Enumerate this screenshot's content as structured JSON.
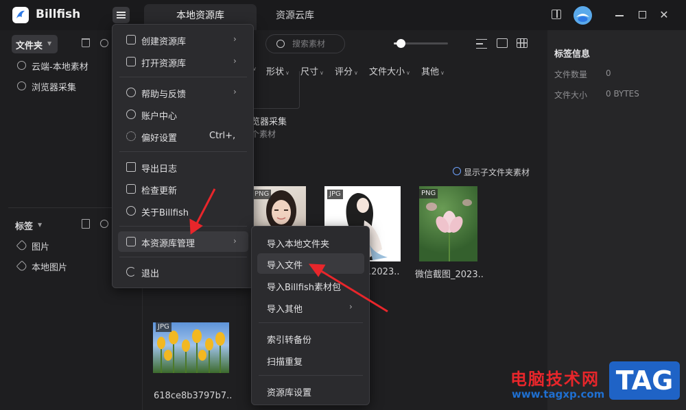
{
  "app": {
    "title": "Billfish",
    "tabs": [
      {
        "label": "本地资源库",
        "active": true
      },
      {
        "label": "资源云库",
        "active": false
      }
    ]
  },
  "sidebar": {
    "folder_header": "文件夹",
    "folders": [
      {
        "label": "云端-本地素材",
        "icon": "cloud-icon"
      },
      {
        "label": "浏览器采集",
        "icon": "compass-icon"
      }
    ],
    "tags_header": "标签",
    "tags": [
      {
        "label": "图片",
        "icon": "tag-icon"
      },
      {
        "label": "本地图片",
        "icon": "tag-icon"
      }
    ]
  },
  "toolbar": {
    "search_placeholder": "搜索素材",
    "filters": [
      "形状",
      "尺寸",
      "评分",
      "文件大小",
      "其他"
    ]
  },
  "content": {
    "folder_card": {
      "name": "览器采集",
      "count": "个素材"
    },
    "show_subfolder": "显示子文件夹素材",
    "thumbnails": [
      {
        "badge": "PNG",
        "name": ""
      },
      {
        "badge": "JPG",
        "name": ".2023.."
      },
      {
        "badge": "PNG",
        "name": "微信截图_2023.."
      },
      {
        "badge": "JPG",
        "name": "618ce8b3797b7.."
      }
    ]
  },
  "right_panel": {
    "title": "标签信息",
    "rows": [
      {
        "label": "文件数量",
        "value": "0"
      },
      {
        "label": "文件大小",
        "value": "0 BYTES"
      }
    ]
  },
  "main_menu": {
    "items": [
      {
        "label": "创建资源库",
        "shortcut": "",
        "has_submenu": true
      },
      {
        "label": "打开资源库",
        "shortcut": "",
        "has_submenu": true
      },
      {
        "label": "帮助与反馈",
        "shortcut": "",
        "has_submenu": true
      },
      {
        "label": "账户中心",
        "shortcut": "",
        "has_submenu": false
      },
      {
        "label": "偏好设置",
        "shortcut": "Ctrl+,",
        "has_submenu": false
      },
      {
        "label": "导出日志",
        "shortcut": "",
        "has_submenu": false
      },
      {
        "label": "检查更新",
        "shortcut": "",
        "has_submenu": false
      },
      {
        "label": "关于Billfish",
        "shortcut": "",
        "has_submenu": false
      },
      {
        "label": "本资源库管理",
        "shortcut": "",
        "has_submenu": true,
        "highlighted": true
      },
      {
        "label": "退出",
        "shortcut": "",
        "has_submenu": false
      }
    ]
  },
  "sub_menu": {
    "items": [
      {
        "label": "导入本地文件夹"
      },
      {
        "label": "导入文件",
        "highlighted": true
      },
      {
        "label": "导入Billfish素材包"
      },
      {
        "label": "导入其他",
        "has_submenu": true
      },
      {
        "label": "索引转备份"
      },
      {
        "label": "扫描重复"
      },
      {
        "label": "资源库设置"
      }
    ]
  },
  "watermark": {
    "text": "电脑技术网",
    "url": "www.tagxp.com",
    "tag": "TAG"
  },
  "colors": {
    "accent": "#4a9be0",
    "annotation_arrow": "#e8262b",
    "background": "#1e1e20",
    "menu_bg": "#2b2b2e"
  }
}
